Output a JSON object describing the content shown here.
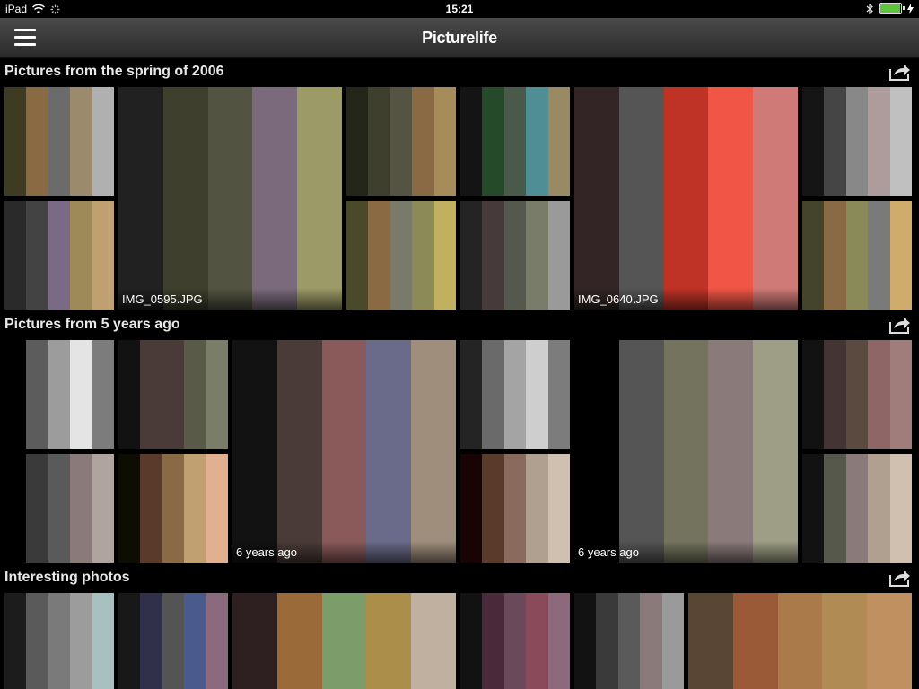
{
  "status": {
    "device": "iPad",
    "time": "15:21"
  },
  "header": {
    "title": "Picturelife"
  },
  "sections": [
    {
      "title": "Pictures from the spring of 2006"
    },
    {
      "title": "Pictures from 5 years ago"
    },
    {
      "title": "Interesting photos"
    }
  ],
  "tiles": [
    {
      "colors": [
        "#3d3b22",
        "#8a6a43",
        "#6b6b6b",
        "#9b8a6b",
        "#b0b0b0"
      ]
    },
    {
      "colors": [
        "#2a2a2a",
        "#434343",
        "#7a6a86",
        "#9e8a58",
        "#c0a070"
      ]
    },
    {
      "colors": [
        "#212121",
        "#3e3f2c",
        "#525340",
        "#7a6a7c",
        "#9c9a66"
      ],
      "caption": "IMG_0595.JPG"
    },
    {
      "colors": [
        "#25261a",
        "#3e3f2c",
        "#555443",
        "#8a6a45",
        "#a58c5a"
      ]
    },
    {
      "colors": [
        "#4a4a2a",
        "#8a6a42",
        "#7a7a6a",
        "#8c8a56",
        "#c0b060"
      ]
    },
    {
      "colors": [
        "#141414",
        "#244a2a",
        "#4a5a4a",
        "#4e8e94",
        "#9a8a64"
      ]
    },
    {
      "colors": [
        "#242424",
        "#473a3a",
        "#55584c",
        "#7a7c6a",
        "#9a9a9a"
      ]
    },
    {
      "colors": [
        "#332525",
        "#555555",
        "#be3326",
        "#f05545",
        "#d07a78"
      ],
      "caption": "IMG_0640.JPG"
    },
    {
      "colors": [
        "#151515",
        "#454545",
        "#888888",
        "#ae9c9c",
        "#c0c0c0"
      ]
    },
    {
      "colors": [
        "#44442c",
        "#8a6a45",
        "#8a8a58",
        "#7a7a7a",
        "#d0ac6c"
      ]
    },
    {
      "colors": [
        "#000000",
        "#5c5c5c",
        "#9c9c9c",
        "#e4e4e4",
        "#7c7c7c"
      ]
    },
    {
      "colors": [
        "#121212",
        "#4a3a38",
        "#4a3a38",
        "#595a48",
        "#7a7e68"
      ]
    },
    {
      "colors": [
        "#000000",
        "#3a3a3a",
        "#5a5a5a",
        "#8a7a7a",
        "#b0a4a0"
      ]
    },
    {
      "colors": [
        "#0d0d04",
        "#5a3a2a",
        "#8a6a45",
        "#c0a070",
        "#e0b090"
      ]
    },
    {
      "colors": [
        "#121212",
        "#4a3a38",
        "#8a5a5a",
        "#6a6a8a",
        "#a08e7c"
      ],
      "caption": "6 years ago"
    },
    {
      "colors": [
        "#242424",
        "#6a6a6a",
        "#a4a4a4",
        "#cecece",
        "#7c7c7c"
      ]
    },
    {
      "colors": [
        "#180404",
        "#5a3a2a",
        "#8a6a5c",
        "#b0a090",
        "#d0c0b0"
      ]
    },
    {
      "colors": [
        "#000000",
        "#555555",
        "#74745e",
        "#8a7a7a",
        "#9e9e86"
      ],
      "caption": "6 years ago"
    },
    {
      "colors": [
        "#121212",
        "#443434",
        "#5a4a40",
        "#8e6666",
        "#a07c7a"
      ]
    },
    {
      "colors": [
        "#121212",
        "#55584a",
        "#8a7a7a",
        "#b0a090",
        "#d0c0b0"
      ]
    },
    {
      "colors": [
        "#1c1c1c",
        "#5a5a5a",
        "#7a7a7a",
        "#9c9c9c",
        "#a8c0c0"
      ]
    },
    {
      "colors": [
        "#181818",
        "#30304a",
        "#545454",
        "#4a5a8c",
        "#8a6a7c"
      ]
    },
    {
      "colors": [
        "#2e2020",
        "#9a6a38",
        "#7c9c6a",
        "#aa8e4a",
        "#c0b0a0"
      ]
    },
    {
      "colors": [
        "#121212",
        "#4a2a3a",
        "#6a4a5a",
        "#8a4a5a",
        "#8c6a7c"
      ]
    },
    {
      "colors": [
        "#121212",
        "#3a3a3a",
        "#5a5a5a",
        "#8a7a7a",
        "#9a9a9a"
      ]
    },
    {
      "colors": [
        "#5a4634",
        "#9a5a38",
        "#aa7a4a",
        "#b08c54",
        "#c09060"
      ]
    }
  ]
}
